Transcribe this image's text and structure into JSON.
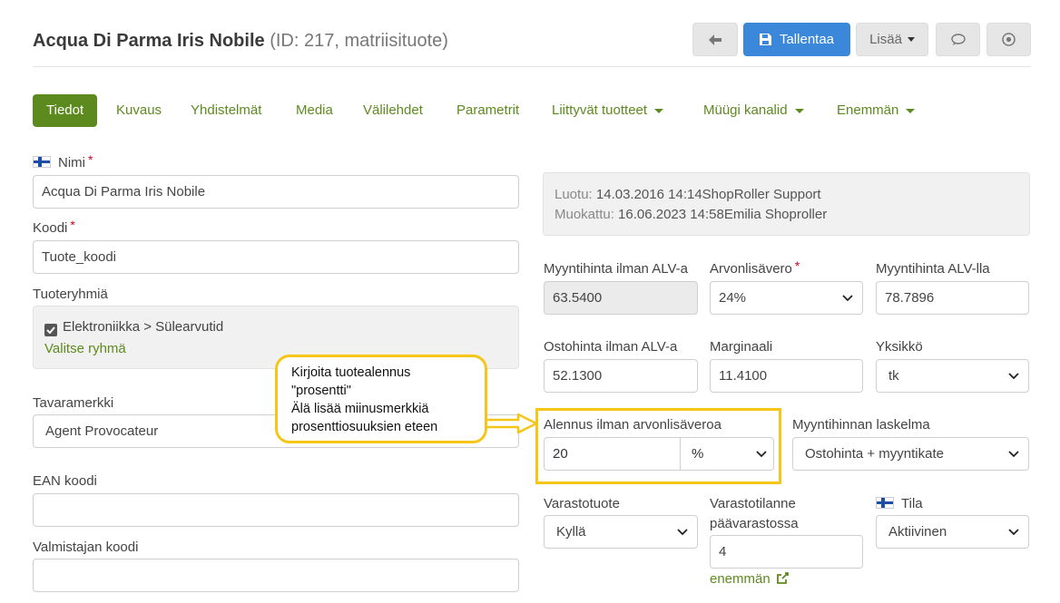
{
  "header": {
    "title": "Acqua Di Parma Iris Nobile",
    "subtitle": "(ID: 217, matriisituote)"
  },
  "toolbar": {
    "save_label": "Tallentaa",
    "more_label": "Lisää"
  },
  "tabs": [
    {
      "label": "Tiedot"
    },
    {
      "label": "Kuvaus"
    },
    {
      "label": "Yhdistelmät"
    },
    {
      "label": "Media"
    },
    {
      "label": "Välilehdet"
    },
    {
      "label": "Parametrit"
    },
    {
      "label": "Liittyvät tuotteet"
    },
    {
      "label": "Müügi kanalid"
    },
    {
      "label": "Enemmän"
    }
  ],
  "form": {
    "name_label": "Nimi",
    "name_value": "Acqua Di Parma Iris Nobile",
    "code_label": "Koodi",
    "code_value": "Tuote_koodi",
    "groups_label": "Tuoteryhmiä",
    "group_item": "Elektroniikka > Sülearvutid",
    "choose_group": "Valitse ryhmä",
    "brand_label": "Tavaramerkki",
    "brand_value": "Agent Provocateur",
    "ean_label": "EAN koodi",
    "ean_value": "",
    "manufacturer_code_label": "Valmistajan koodi",
    "manufacturer_code_value": ""
  },
  "info": {
    "created_label": "Luotu:",
    "created_value": "14.03.2016 14:14ShopRoller Support",
    "modified_label": "Muokattu:",
    "modified_value": "16.06.2023 14:58Emilia Shoproller"
  },
  "pricing": {
    "price_excl_label": "Myyntihinta ilman ALV-a",
    "price_excl_value": "63.5400",
    "vat_label": "Arvonlisävero",
    "vat_value": "24%",
    "price_incl_label": "Myyntihinta ALV-lla",
    "price_incl_value": "78.7896",
    "purchase_label": "Ostohinta ilman ALV-a",
    "purchase_value": "52.1300",
    "margin_label": "Marginaali",
    "margin_value": "11.4100",
    "unit_label": "Yksikkö",
    "unit_value": "tk",
    "discount_label": "Alennus ilman arvonlisäveroa",
    "discount_value": "20",
    "discount_unit": "%",
    "calc_label": "Myyntihinnan laskelma",
    "calc_value": "Ostohinta + myyntikate",
    "stock_product_label": "Varastotuote",
    "stock_product_value": "Kyllä",
    "stock_status_label_1": "Varastotilanne",
    "stock_status_label_2": "päävarastossa",
    "stock_status_value": "4",
    "more_link": "enemmän",
    "status_label": "Tila",
    "status_value": "Aktiivinen"
  },
  "callout": {
    "line1": "Kirjoita tuotealennus",
    "line2": "\"prosentti\"",
    "line3": "Älä lisää miinusmerkkiä",
    "line4": "prosenttiosuuksien eteen"
  },
  "colors": {
    "accent_green": "#5d8a1e",
    "primary_blue": "#3b87d9",
    "highlight_yellow": "#f5c518"
  }
}
